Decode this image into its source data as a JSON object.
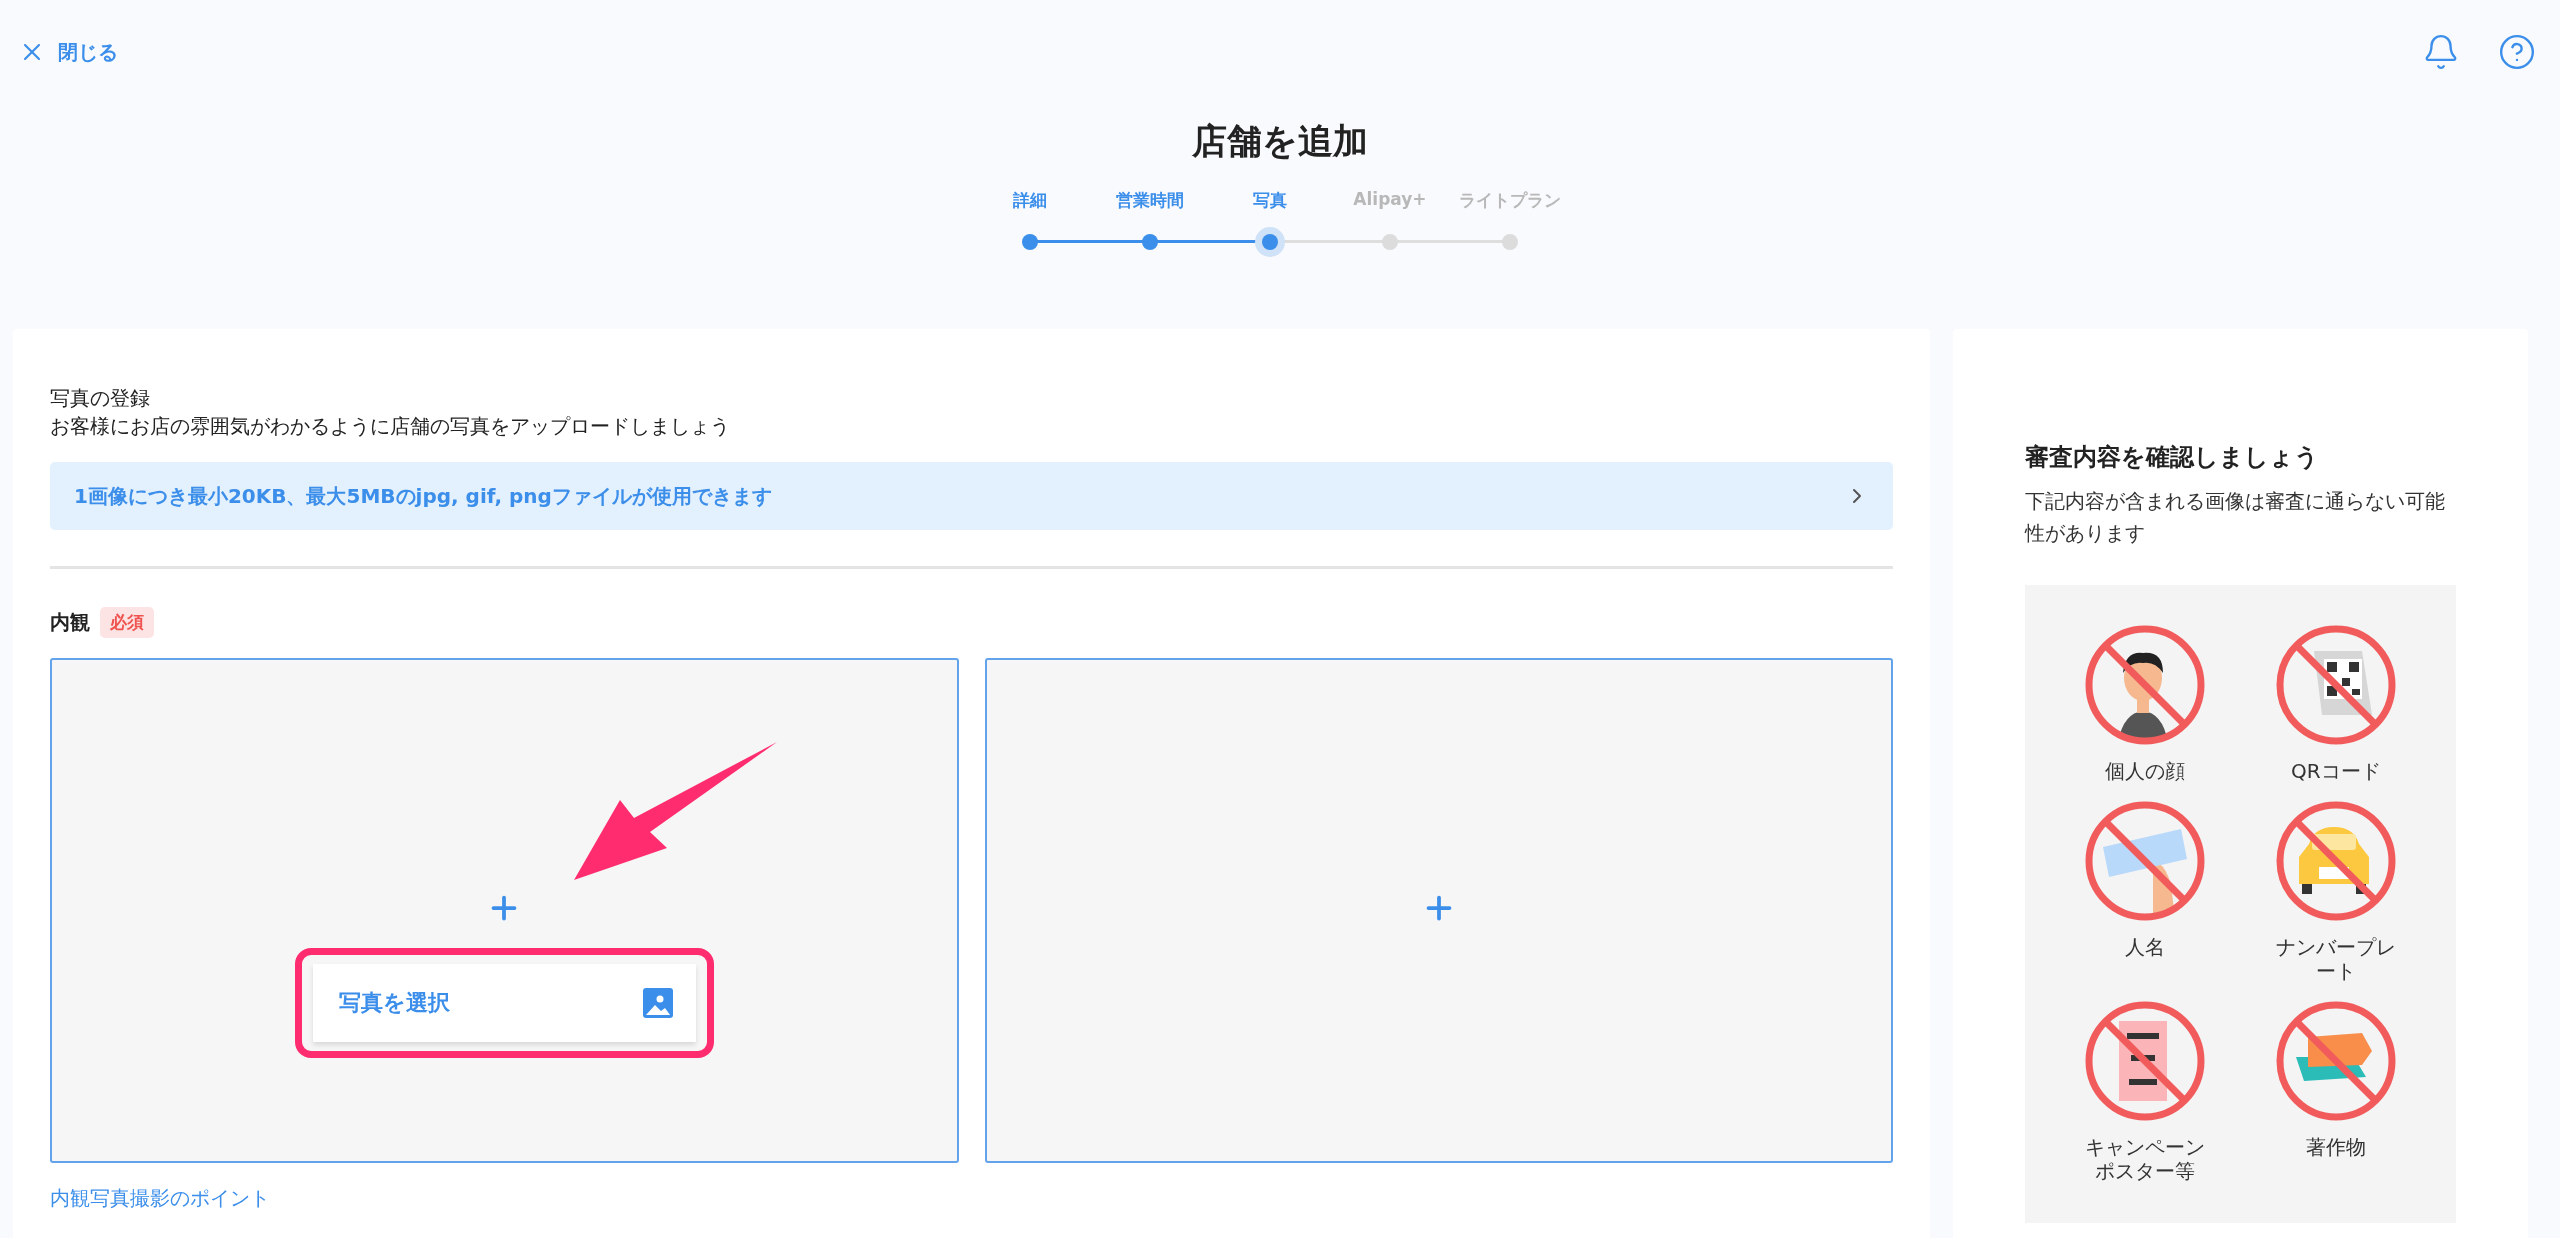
{
  "header": {
    "close_label": "閉じる"
  },
  "title": "店舗を追加",
  "steps": [
    {
      "label": "詳細",
      "reached": true,
      "selected": false
    },
    {
      "label": "営業時間",
      "reached": true,
      "selected": false
    },
    {
      "label": "写真",
      "reached": true,
      "selected": true
    },
    {
      "label": "Alipay+",
      "reached": false,
      "selected": false
    },
    {
      "label": "ライトプラン",
      "reached": false,
      "selected": false
    }
  ],
  "main": {
    "heading": "写真の登録",
    "description": "お客様にお店の雰囲気がわかるように店舗の写真をアップロードしましょう",
    "info": "1画像につき最小20KB、最大5MBのjpg, gif, pngファイルが使用できます",
    "section": {
      "label": "内観",
      "badge": "必須",
      "slots": [
        {
          "kind": "with-button",
          "button_label": "写真を選択"
        },
        {
          "kind": "empty"
        }
      ],
      "link": "内観写真撮影のポイント"
    }
  },
  "review": {
    "title": "審査内容を確認しましょう",
    "description": "下記内容が含まれる画像は審査に通らない可能性があります",
    "items": [
      {
        "kind": "person",
        "label": "個人の顔"
      },
      {
        "kind": "qr",
        "label": "QRコード"
      },
      {
        "kind": "name",
        "label": "人名"
      },
      {
        "kind": "plate",
        "label": "ナンバープレート"
      },
      {
        "kind": "poster",
        "label": "キャンペーンポスター等"
      },
      {
        "kind": "books",
        "label": "著作物"
      }
    ]
  }
}
